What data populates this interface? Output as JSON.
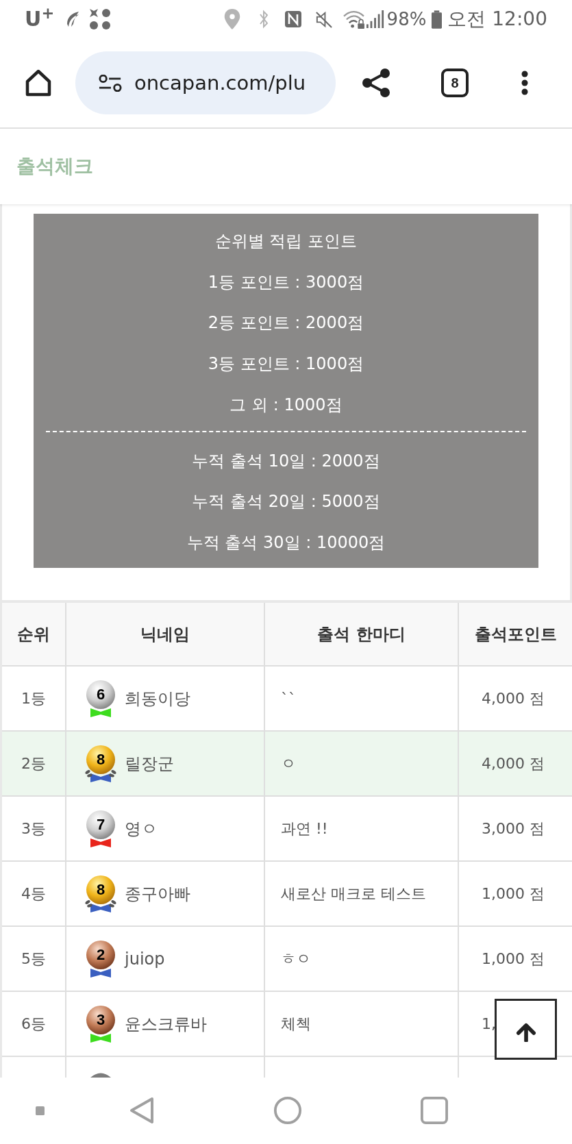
{
  "status_bar": {
    "carrier": "U$^{+}$",
    "battery": "98%",
    "time": "오전 12:00"
  },
  "browser": {
    "url": "oncapan.com/plu",
    "tab_count": "8"
  },
  "page_title": "출석체크",
  "points_info": {
    "title": "순위별 적립 포인트",
    "rank_points": [
      "1등 포인트 : 3000점",
      "2등 포인트 : 2000점",
      "3등 포인트 : 1000점",
      "그 외 : 1000점"
    ],
    "streak_points": [
      "누적 출석 10일 : 2000점",
      "누적 출석 20일 : 5000점",
      "누적 출석 30일 : 10000점"
    ]
  },
  "table": {
    "columns": [
      "순위",
      "닉네임",
      "출석 한마디",
      "출석포인트"
    ],
    "rows": [
      {
        "rank": "1등",
        "medal": {
          "kind": "silver",
          "number": "6",
          "color": "#3ddc1e"
        },
        "nickname": "희동이당",
        "comment": "``",
        "points": "4,000 점",
        "highlighted": false
      },
      {
        "rank": "2등",
        "medal": {
          "kind": "gold",
          "number": "8",
          "color": "#3a5fc0"
        },
        "nickname": "릴장군",
        "comment": "ㅇ",
        "points": "4,000 점",
        "highlighted": true
      },
      {
        "rank": "3등",
        "medal": {
          "kind": "silver",
          "number": "7",
          "color": "#e8251c"
        },
        "nickname": "영ㅇ",
        "comment": "과연 !!",
        "points": "3,000 점",
        "highlighted": false
      },
      {
        "rank": "4등",
        "medal": {
          "kind": "gold",
          "number": "8",
          "color": "#3a5fc0"
        },
        "nickname": "종구아빠",
        "comment": "새로산 매크로 테스트",
        "points": "1,000 점",
        "highlighted": false
      },
      {
        "rank": "5등",
        "medal": {
          "kind": "bronze",
          "number": "2",
          "color": "#3a5fc0"
        },
        "nickname": "juiop",
        "comment": "ㅎㅇ",
        "points": "1,000 점",
        "highlighted": false
      },
      {
        "rank": "6등",
        "medal": {
          "kind": "bronze",
          "number": "3",
          "color": "#3ddc1e"
        },
        "nickname": "윤스크류바",
        "comment": "체첵",
        "points": "1,",
        "highlighted": false
      },
      {
        "medal": {
          "kind": "silver"
        },
        "highlighted": false
      }
    ]
  }
}
